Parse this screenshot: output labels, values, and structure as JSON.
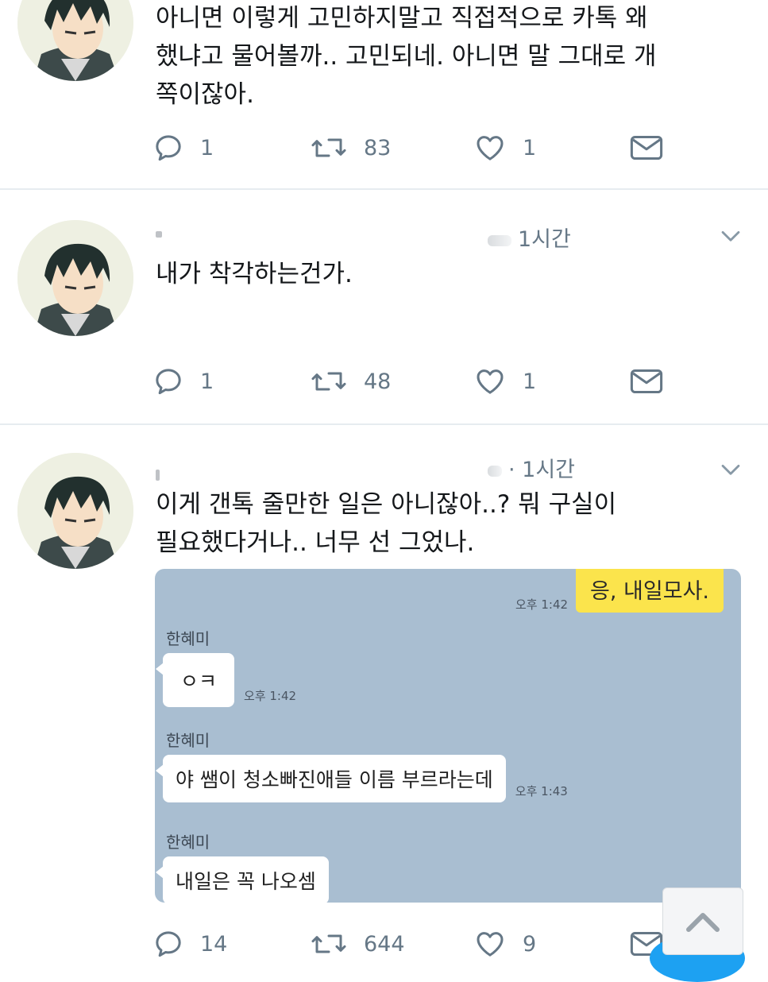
{
  "tweets": [
    {
      "time": "",
      "text": "아니면 이렇게 고민하지말고 직접적으로 카톡 왜\n했냐고 물어볼까.. 고민되네. 아니면 말 그대로 개\n쪽이잖아.",
      "reply_count": "1",
      "retweet_count": "83",
      "like_count": "1"
    },
    {
      "time": "1시간",
      "text": "내가 착각하는건가.",
      "reply_count": "1",
      "retweet_count": "48",
      "like_count": "1"
    },
    {
      "time": "· 1시간",
      "text": "이게 갠톡 줄만한 일은 아니잖아..? 뭐 구실이\n필요했다거나.. 너무 선 그었나.",
      "reply_count": "14",
      "retweet_count": "644",
      "like_count": "9"
    }
  ],
  "chat": {
    "my_message": "응, 내일모사.",
    "my_time": "오후 1:42",
    "messages": [
      {
        "sender": "한혜미",
        "text": "ㅇㅋ",
        "time": "오후 1:42"
      },
      {
        "sender": "한혜미",
        "text": "야 쌤이 청소빠진애들 이름 부르라는데",
        "time": "오후 1:43"
      },
      {
        "sender": "한혜미",
        "text": "내일은 꼭 나오셈",
        "time": ""
      }
    ]
  },
  "icons": {
    "reply": "reply-icon",
    "retweet": "retweet-icon",
    "like": "heart-icon",
    "dm": "envelope-icon",
    "more": "chevron-down-icon",
    "scroll": "chevron-up-icon"
  },
  "colors": {
    "icon_gray": "#657786",
    "chat_bg": "#a9bed1",
    "my_bubble": "#fbe44c",
    "divider": "#e6ecf0"
  }
}
